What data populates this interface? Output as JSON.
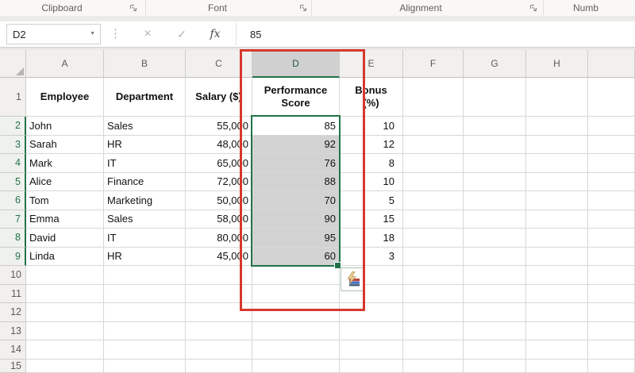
{
  "ribbon": {
    "groups": [
      {
        "label": "Clipboard"
      },
      {
        "label": "Font"
      },
      {
        "label": "Alignment"
      },
      {
        "label": "Numb"
      }
    ]
  },
  "formula_bar": {
    "name_box": "D2",
    "cancel_glyph": "×",
    "enter_glyph": "✓",
    "fx_label": "fx",
    "formula": "85",
    "dropdown_glyph": "▼",
    "splitter_glyph": "⋮"
  },
  "sheet": {
    "column_letters": [
      "A",
      "B",
      "C",
      "D",
      "E",
      "F",
      "G",
      "H",
      ""
    ],
    "selected_column_index": 3,
    "selected_row_numbers": [
      "2",
      "3",
      "4",
      "5",
      "6",
      "7",
      "8",
      "9"
    ],
    "active_cell": "D2",
    "rows": [
      {
        "n": "1",
        "header": true,
        "cells": [
          "Employee",
          "Department",
          "Salary ($)",
          "Performance\nScore",
          "Bonus\n(%)",
          "",
          "",
          "",
          ""
        ]
      },
      {
        "n": "2",
        "cells": [
          "John",
          "Sales",
          "55,000",
          "85",
          "10",
          "",
          "",
          "",
          ""
        ]
      },
      {
        "n": "3",
        "cells": [
          "Sarah",
          "HR",
          "48,000",
          "92",
          "12",
          "",
          "",
          "",
          ""
        ]
      },
      {
        "n": "4",
        "cells": [
          "Mark",
          "IT",
          "65,000",
          "76",
          "8",
          "",
          "",
          "",
          ""
        ]
      },
      {
        "n": "5",
        "cells": [
          "Alice",
          "Finance",
          "72,000",
          "88",
          "10",
          "",
          "",
          "",
          ""
        ]
      },
      {
        "n": "6",
        "cells": [
          "Tom",
          "Marketing",
          "50,000",
          "70",
          "5",
          "",
          "",
          "",
          ""
        ]
      },
      {
        "n": "7",
        "cells": [
          "Emma",
          "Sales",
          "58,000",
          "90",
          "15",
          "",
          "",
          "",
          ""
        ]
      },
      {
        "n": "8",
        "cells": [
          "David",
          "IT",
          "80,000",
          "95",
          "18",
          "",
          "",
          "",
          ""
        ]
      },
      {
        "n": "9",
        "cells": [
          "Linda",
          "HR",
          "45,000",
          "60",
          "3",
          "",
          "",
          "",
          ""
        ]
      },
      {
        "n": "10",
        "cells": [
          "",
          "",
          "",
          "",
          "",
          "",
          "",
          "",
          ""
        ]
      },
      {
        "n": "11",
        "cells": [
          "",
          "",
          "",
          "",
          "",
          "",
          "",
          "",
          ""
        ]
      },
      {
        "n": "12",
        "cells": [
          "",
          "",
          "",
          "",
          "",
          "",
          "",
          "",
          ""
        ]
      },
      {
        "n": "13",
        "cells": [
          "",
          "",
          "",
          "",
          "",
          "",
          "",
          "",
          ""
        ]
      },
      {
        "n": "14",
        "cells": [
          "",
          "",
          "",
          "",
          "",
          "",
          "",
          "",
          ""
        ]
      },
      {
        "n": "15",
        "cells": [
          "",
          "",
          "",
          "",
          "",
          "",
          "",
          "",
          ""
        ]
      }
    ]
  },
  "colors": {
    "selection_green": "#217346",
    "selection_fill": "#d2d2d2",
    "annotation_red": "#d6382e",
    "header_bg": "#f1f0ef",
    "gridline": "#d8d8d8"
  }
}
